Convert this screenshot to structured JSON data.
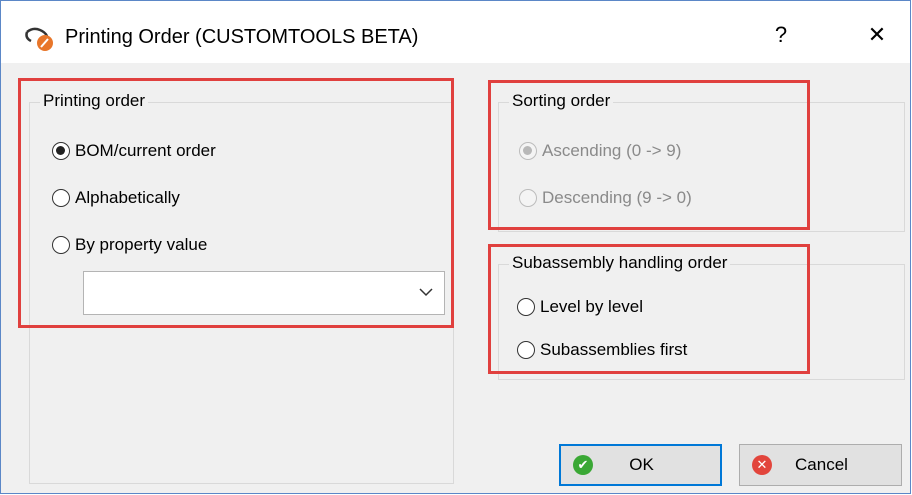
{
  "window": {
    "title": "Printing Order (CUSTOMTOOLS BETA)",
    "help_glyph": "?",
    "close_glyph": "✕"
  },
  "printing_order": {
    "legend": "Printing order",
    "options": [
      {
        "label": "BOM/current order",
        "checked": true
      },
      {
        "label": "Alphabetically",
        "checked": false
      },
      {
        "label": "By property value",
        "checked": false
      }
    ],
    "property_value": ""
  },
  "sorting_order": {
    "legend": "Sorting order",
    "options": [
      {
        "label": "Ascending (0 -> 9)",
        "checked": true,
        "enabled": false
      },
      {
        "label": "Descending (9 -> 0)",
        "checked": false,
        "enabled": false
      }
    ]
  },
  "subassembly_order": {
    "legend": "Subassembly handling order",
    "options": [
      {
        "label": "Level by level",
        "checked": false
      },
      {
        "label": "Subassemblies first",
        "checked": false
      }
    ]
  },
  "buttons": {
    "ok": "OK",
    "cancel": "Cancel"
  },
  "colors": {
    "highlight": "#e0403e",
    "ok_icon": "#3aa835",
    "cancel_icon": "#e2453c",
    "focus_border": "#0078d7"
  }
}
